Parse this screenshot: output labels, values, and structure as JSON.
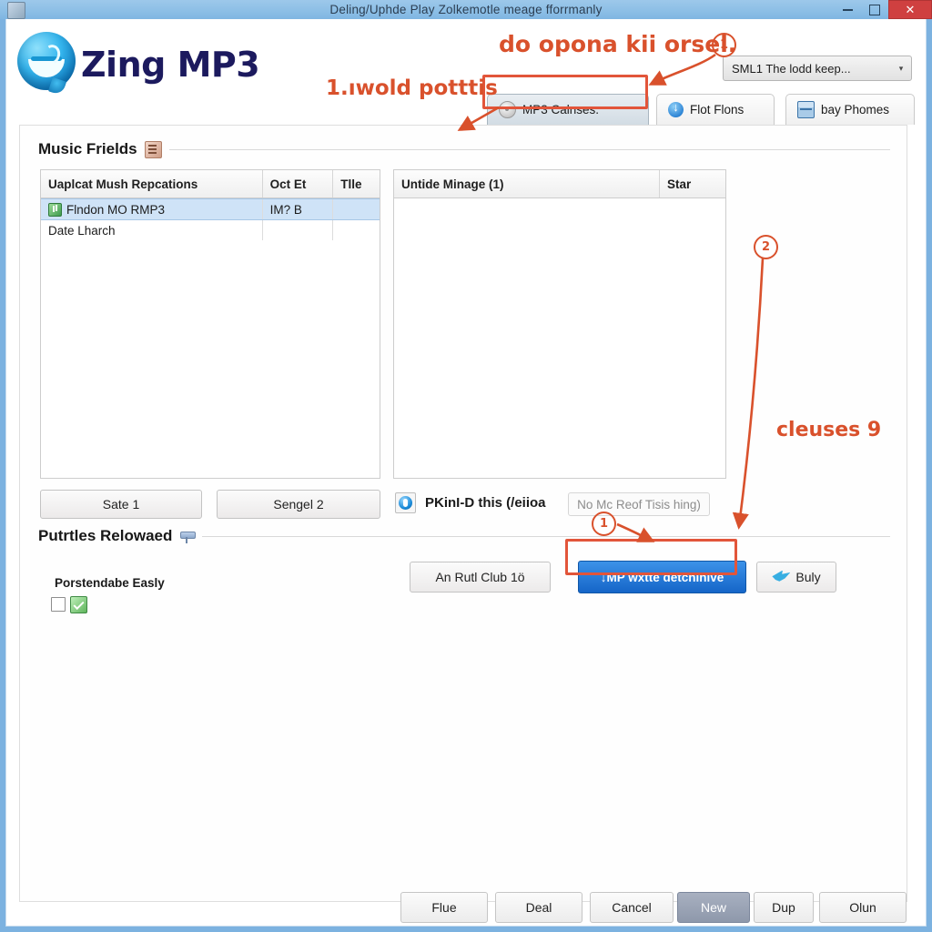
{
  "window": {
    "title": "Deling/Uphde Play Zolkemotle meage fforrmanly",
    "app_icon": "app-icon",
    "minimize_label": "–",
    "maximize_label": "□",
    "close_label": "✕"
  },
  "brand": {
    "name": "Zing MP3",
    "logo": "zing-mp3-smiley-logo"
  },
  "top_combo": {
    "value": "SML1 The lodd keep...",
    "caret": "▾"
  },
  "tabs": [
    {
      "label": "MP3 Calnses.",
      "icon": "disc-icon",
      "active": true
    },
    {
      "label": "Flot Flons",
      "icon": "download-circle-icon",
      "active": false
    },
    {
      "label": "bay Phomes",
      "icon": "calendar-box-icon",
      "active": false
    }
  ],
  "groups": {
    "music_fields": {
      "title": "Music Frields",
      "icon": "note-icon"
    },
    "profiles": {
      "title": "Putrtles Relowaed",
      "icon": "pin-icon"
    }
  },
  "left_list": {
    "columns": [
      "Uaplcat Mush Repcations",
      "Oct Et",
      "Tlle"
    ],
    "rows": [
      {
        "name": "Flndon MO RMP3",
        "type": "IM? B",
        "extra": "",
        "selected": true,
        "icon": "mp3-file-icon"
      },
      {
        "name": "Date Lharch",
        "type": "",
        "extra": "",
        "selected": false,
        "icon": ""
      }
    ]
  },
  "right_list": {
    "columns": [
      "Untide Minage (1)",
      "Star"
    ],
    "rows": []
  },
  "left_buttons": [
    {
      "label": "Sate 1"
    },
    {
      "label": "Sengel 2"
    }
  ],
  "radio_row": {
    "icon": "blue-info-icon",
    "label": "PKinI-D this (/eiioa",
    "hint": "No Mc Reof Tisis hing)"
  },
  "profiles_section": {
    "caption": "Porstendabe Easly",
    "checkbox_checked": false,
    "green_icon": "green-check-icon"
  },
  "action_buttons": [
    {
      "label": "An Rutl Club 1ö",
      "style": "normal",
      "name": "an-rutl-club-button"
    },
    {
      "label": "↓MP wxtte detcninive",
      "style": "primary",
      "name": "mp-write-button"
    },
    {
      "label": "Buly",
      "style": "twitter",
      "name": "buly-button",
      "icon": "twitter-bird-icon"
    }
  ],
  "footer_buttons": [
    {
      "label": "Flue",
      "selected": false
    },
    {
      "label": "Deal",
      "selected": false
    },
    {
      "label": "Cancel",
      "selected": false
    },
    {
      "label": "New",
      "selected": true
    },
    {
      "label": "Dup",
      "selected": false
    },
    {
      "label": "Olun",
      "selected": false
    }
  ],
  "annotations": {
    "note_top": "do opona kii orsel.",
    "note_left": "1.ıwold potttis",
    "note_right": "cleuses 9",
    "marker_1a": "1",
    "marker_1b": "1",
    "marker_2": "2"
  },
  "colors": {
    "title_bar": "#8dbfe6",
    "close_button": "#cf4040",
    "annotation": "#d9512c",
    "highlight_box": "#e2553a",
    "primary_button": "#1565c8",
    "selection_row": "#cfe3f7",
    "brand_text": "#1c1a5e"
  }
}
